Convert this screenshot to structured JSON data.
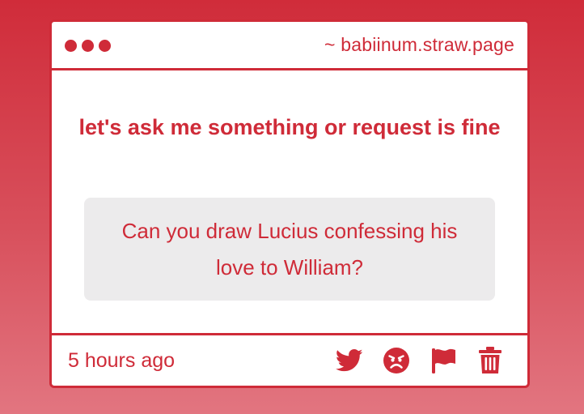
{
  "window": {
    "url": "~ babiinum.straw.page"
  },
  "question": {
    "prompt": "let's ask me something or request is fine",
    "text": "Can you draw Lucius confessing his love to William?"
  },
  "footer": {
    "timestamp": "5 hours ago",
    "actions": [
      "twitter-icon",
      "angry-face-icon",
      "flag-icon",
      "trash-icon"
    ]
  },
  "colors": {
    "accent": "#cf2b38",
    "question_bg": "#ecebec",
    "card_bg": "#ffffff"
  }
}
